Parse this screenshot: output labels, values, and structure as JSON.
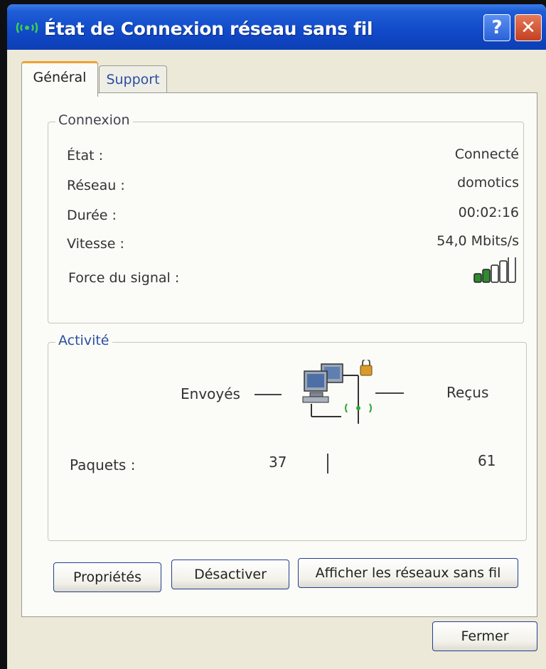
{
  "window": {
    "title": "État de Connexion réseau sans fil",
    "help_label": "?",
    "close_label": "✕"
  },
  "tabs": [
    {
      "label": "Général",
      "selected": true
    },
    {
      "label": "Support",
      "selected": false
    }
  ],
  "connexion": {
    "legend": "Connexion",
    "rows": [
      {
        "label": "État :",
        "value": "Connecté"
      },
      {
        "label": "Réseau :",
        "value": "domotics"
      },
      {
        "label": "Durée :",
        "value": "00:02:16"
      },
      {
        "label": "Vitesse :",
        "value": "54,0 Mbits/s"
      }
    ],
    "signal_label": "Force du signal :",
    "signal_bars_total": 5,
    "signal_bars_lit": 2
  },
  "activite": {
    "legend": "Activité",
    "sent_label": "Envoyés",
    "received_label": "Reçus",
    "packets_label": "Paquets :",
    "packets_sent": "37",
    "packets_received": "61"
  },
  "buttons": {
    "properties": "Propriétés",
    "disable": "Désactiver",
    "show_networks": "Afficher les réseaux sans fil",
    "close": "Fermer"
  },
  "colors": {
    "titlebar": "#1149c8",
    "signal_on": "#2e8b2e",
    "signal_off": "#ffffff"
  }
}
